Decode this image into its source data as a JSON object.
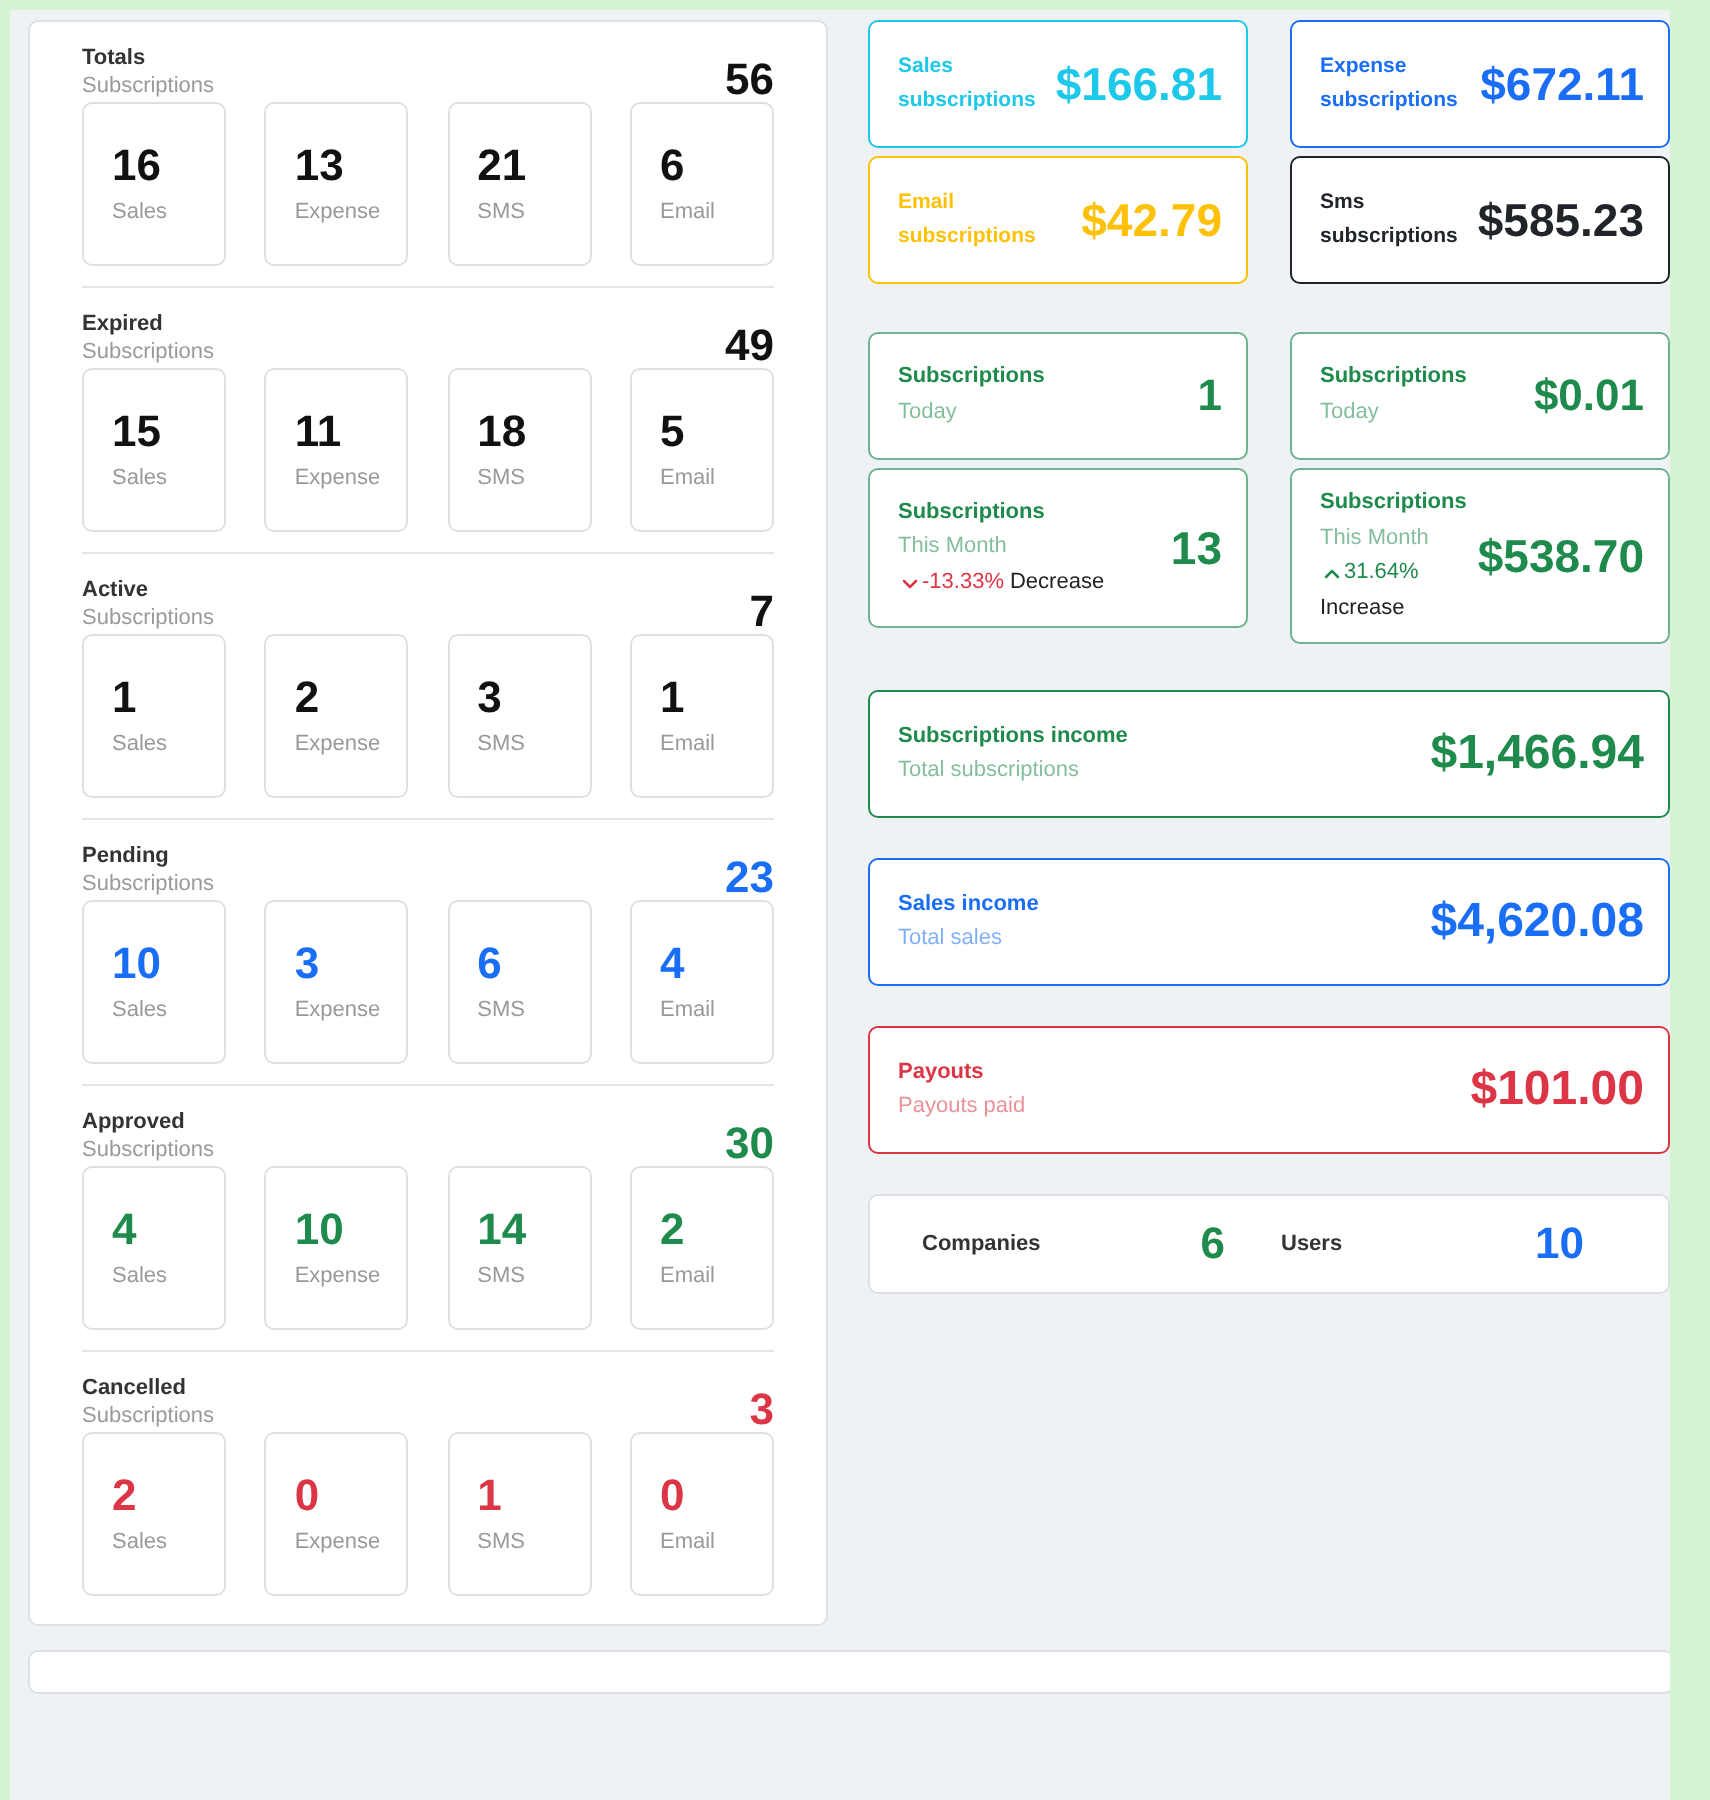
{
  "left_panel": {
    "sections": [
      {
        "title": "Totals",
        "subtitle": "Subscriptions",
        "total": "56",
        "color": "#111111",
        "tiles": [
          {
            "value": "16",
            "label": "Sales"
          },
          {
            "value": "13",
            "label": "Expense"
          },
          {
            "value": "21",
            "label": "SMS"
          },
          {
            "value": "6",
            "label": "Email"
          }
        ]
      },
      {
        "title": "Expired",
        "subtitle": "Subscriptions",
        "total": "49",
        "color": "#111111",
        "tiles": [
          {
            "value": "15",
            "label": "Sales"
          },
          {
            "value": "11",
            "label": "Expense"
          },
          {
            "value": "18",
            "label": "SMS"
          },
          {
            "value": "5",
            "label": "Email"
          }
        ]
      },
      {
        "title": "Active",
        "subtitle": "Subscriptions",
        "total": "7",
        "color": "#111111",
        "tiles": [
          {
            "value": "1",
            "label": "Sales"
          },
          {
            "value": "2",
            "label": "Expense"
          },
          {
            "value": "3",
            "label": "SMS"
          },
          {
            "value": "1",
            "label": "Email"
          }
        ]
      },
      {
        "title": "Pending",
        "subtitle": "Subscriptions",
        "total": "23",
        "color": "#1a6ef5",
        "tiles": [
          {
            "value": "10",
            "label": "Sales"
          },
          {
            "value": "3",
            "label": "Expense"
          },
          {
            "value": "6",
            "label": "SMS"
          },
          {
            "value": "4",
            "label": "Email"
          }
        ]
      },
      {
        "title": "Approved",
        "subtitle": "Subscriptions",
        "total": "30",
        "color": "#1e8a4c",
        "tiles": [
          {
            "value": "4",
            "label": "Sales"
          },
          {
            "value": "10",
            "label": "Expense"
          },
          {
            "value": "14",
            "label": "SMS"
          },
          {
            "value": "2",
            "label": "Email"
          }
        ]
      },
      {
        "title": "Cancelled",
        "subtitle": "Subscriptions",
        "total": "3",
        "color": "#dc3545",
        "tiles": [
          {
            "value": "2",
            "label": "Sales"
          },
          {
            "value": "0",
            "label": "Expense"
          },
          {
            "value": "1",
            "label": "SMS"
          },
          {
            "value": "0",
            "label": "Email"
          }
        ]
      }
    ]
  },
  "summary_cards": [
    {
      "title": "Sales subscriptions",
      "value": "$166.81",
      "color": "#1ec8ea"
    },
    {
      "title": "Expense subscriptions",
      "value": "$672.11",
      "color": "#1a6ef5"
    },
    {
      "title": "Email subscriptions",
      "value": "$42.79",
      "color": "#ffc107"
    },
    {
      "title": "Sms subscriptions",
      "value": "$585.23",
      "color": "#212529"
    }
  ],
  "daily_cards": [
    {
      "title": "Subscriptions",
      "period": "Today",
      "value": "1"
    },
    {
      "title": "Subscriptions",
      "period": "Today",
      "value": "$0.01"
    },
    {
      "title": "Subscriptions",
      "period": "This Month",
      "value": "13",
      "change": {
        "kind": "down",
        "text": "-13.33%",
        "word": "Decrease"
      }
    },
    {
      "title": "Subscriptions",
      "period": "This Month",
      "value": "$538.70",
      "change": {
        "kind": "up",
        "text": "31.64%",
        "word": "Increase"
      }
    }
  ],
  "income_cards": [
    {
      "title": "Subscriptions income",
      "subtitle": "Total subscriptions",
      "value": "$1,466.94",
      "color": "#1e8a4c"
    },
    {
      "title": "Sales income",
      "subtitle": "Total sales",
      "value": "$4,620.08",
      "color": "#1a6ef5"
    },
    {
      "title": "Payouts",
      "subtitle": "Payouts paid",
      "value": "$101.00",
      "color": "#dc3545"
    }
  ],
  "counts": [
    {
      "label": "Companies",
      "value": "6",
      "color": "#1e8a4c"
    },
    {
      "label": "Users",
      "value": "10",
      "color": "#1a6ef5"
    }
  ]
}
